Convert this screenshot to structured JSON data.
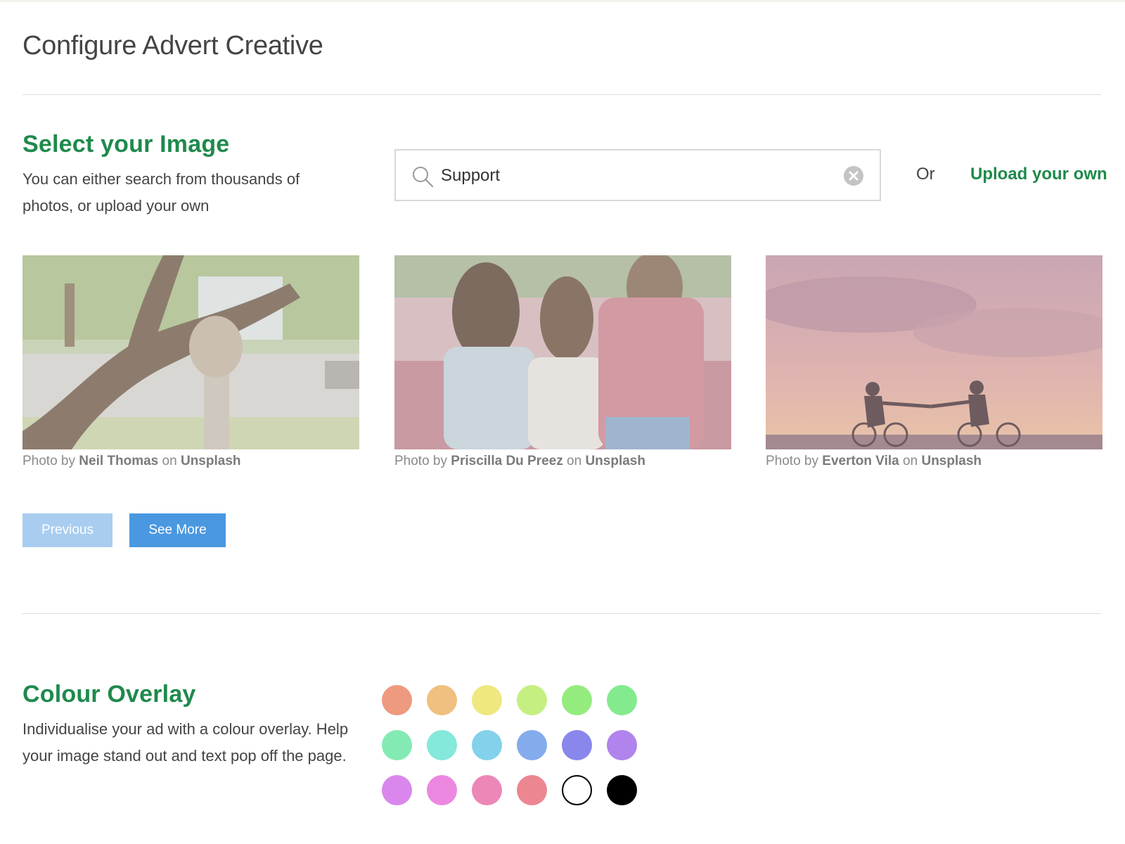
{
  "page": {
    "title": "Configure Advert Creative"
  },
  "image_section": {
    "heading": "Select your Image",
    "description": "You can either search from thousands of photos, or upload your own",
    "search": {
      "value": "Support"
    },
    "or_label": "Or",
    "upload_label": "Upload your own",
    "photos": [
      {
        "prefix": "Photo by",
        "author": "Neil Thomas",
        "joiner": "on",
        "source": "Unsplash"
      },
      {
        "prefix": "Photo by",
        "author": "Priscilla Du Preez",
        "joiner": "on",
        "source": "Unsplash"
      },
      {
        "prefix": "Photo by",
        "author": "Everton Vila",
        "joiner": "on",
        "source": "Unsplash"
      }
    ],
    "previous_label": "Previous",
    "see_more_label": "See More"
  },
  "overlay_section": {
    "heading": "Colour Overlay",
    "description": "Individualise your ad with a colour overlay. Help your image stand out and text pop off the page.",
    "colors": [
      "#ee9a7f",
      "#efc07f",
      "#efe880",
      "#c6ef82",
      "#94ec7f",
      "#84ea8e",
      "#84eab4",
      "#84e8da",
      "#84d1ec",
      "#84abec",
      "#8a87ec",
      "#b084ec",
      "#d987ec",
      "#ec87e0",
      "#ec87b7",
      "#ec8690",
      "#ffffff",
      "#000000"
    ]
  },
  "colors": {
    "accent_green": "#1e8a4c",
    "primary_blue": "#4a98e0",
    "disabled_blue": "#a9cdf1"
  }
}
